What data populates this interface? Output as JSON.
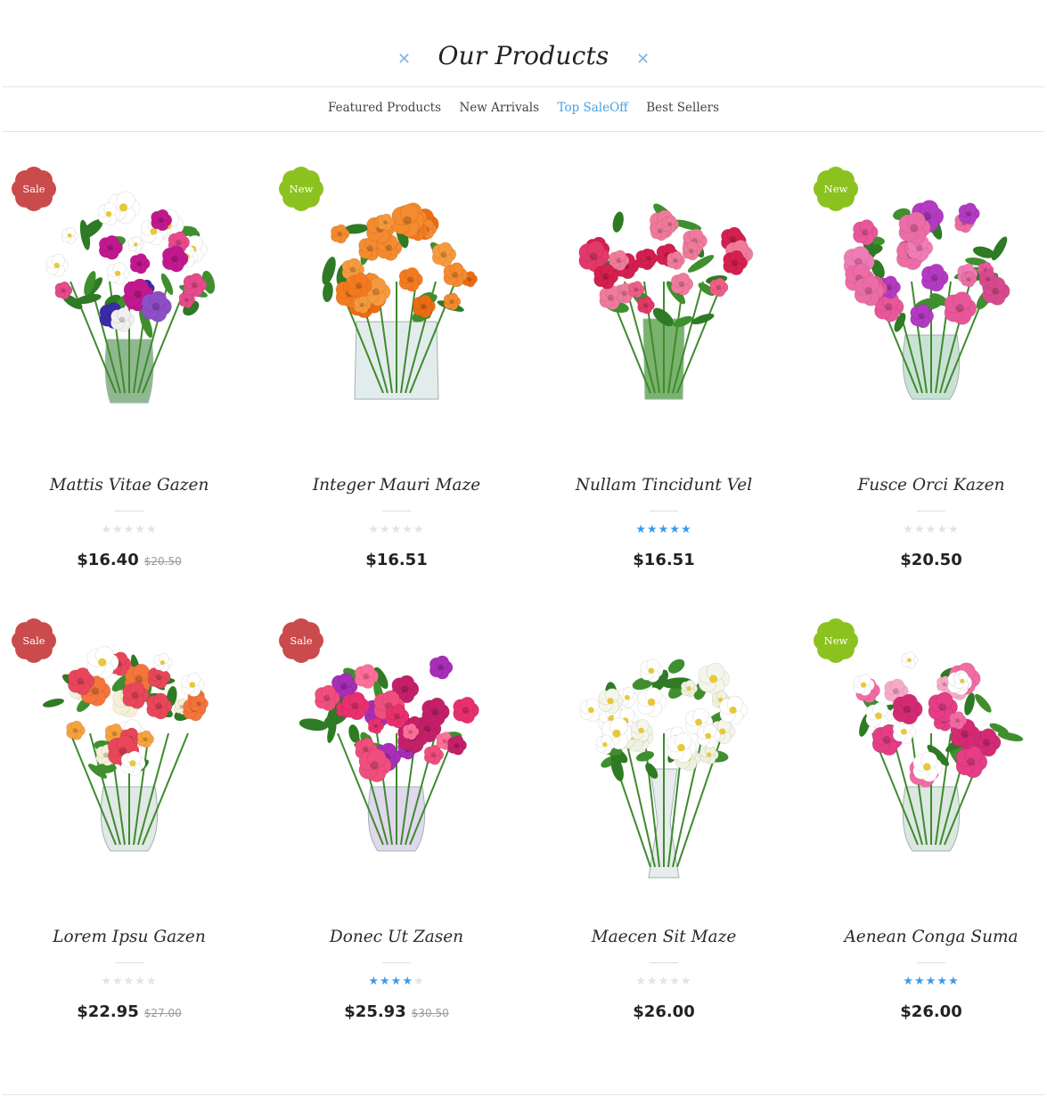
{
  "section": {
    "title": "Our Products",
    "deco_icon": "cross-icon",
    "accent_color": "#4aa0e0"
  },
  "tabs": [
    {
      "label": "Featured Products",
      "active": false
    },
    {
      "label": "New Arrivals",
      "active": false
    },
    {
      "label": "Top SaleOff",
      "active": true
    },
    {
      "label": "Best Sellers",
      "active": false
    }
  ],
  "badge_colors": {
    "Sale": "#c94b4b",
    "New": "#8cc21f"
  },
  "products": [
    {
      "name": "Mattis Vitae Gazen",
      "badge": "Sale",
      "rating": 0,
      "price": "$16.40",
      "old_price": "$20.50",
      "image": "mixed-bouquet-vase"
    },
    {
      "name": "Integer Mauri Maze",
      "badge": "New",
      "rating": 0,
      "price": "$16.51",
      "old_price": "",
      "image": "orange-roses-cube-vase"
    },
    {
      "name": "Nullam Tincidunt Vel",
      "badge": "",
      "rating": 5,
      "price": "$16.51",
      "old_price": "",
      "image": "red-tulips-ribbon-vase"
    },
    {
      "name": "Fusce Orci Kazen",
      "badge": "New",
      "rating": 0,
      "price": "$20.50",
      "old_price": "",
      "image": "pink-roses-bouquet"
    },
    {
      "name": "Lorem Ipsu Gazen",
      "badge": "Sale",
      "rating": 0,
      "price": "$22.95",
      "old_price": "$27.00",
      "image": "peony-bouquet"
    },
    {
      "name": "Donec Ut Zasen",
      "badge": "Sale",
      "rating": 4,
      "price": "$25.93",
      "old_price": "$30.50",
      "image": "pink-carnation-bouquet"
    },
    {
      "name": "Maecen Sit Maze",
      "badge": "",
      "rating": 0,
      "price": "$26.00",
      "old_price": "",
      "image": "white-stock-tall-vase"
    },
    {
      "name": "Aenean Conga Suma",
      "badge": "New",
      "rating": 5,
      "price": "$26.00",
      "old_price": "",
      "image": "pink-lilies-bouquet"
    }
  ]
}
